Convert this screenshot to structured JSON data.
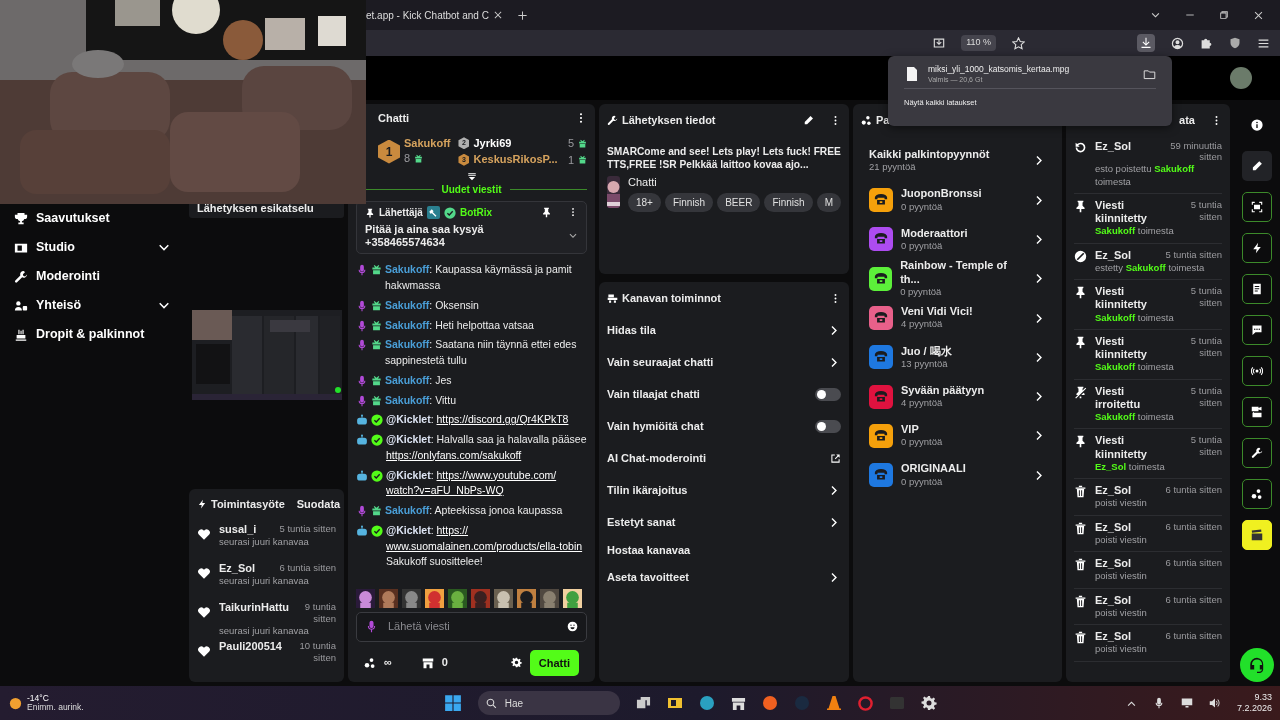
{
  "browser": {
    "tab_title": "et.app - Kick Chatbot and C",
    "zoom": "110 %"
  },
  "download": {
    "filename": "miksi_yli_1000_katsomis_kertaa.mpg",
    "status": "Valmis — 20,6 Gt",
    "show_all": "Näytä kaikki lataukset"
  },
  "sidebar": {
    "items": [
      {
        "label": "Saavutukset",
        "kind": "link"
      },
      {
        "label": "Studio",
        "kind": "group"
      },
      {
        "label": "Moderointi",
        "kind": "link"
      },
      {
        "label": "Yhteisö",
        "kind": "group"
      },
      {
        "label": "Dropit & palkinnot",
        "kind": "link"
      }
    ]
  },
  "preview": {
    "title": "Lähetyksen esikatselu"
  },
  "activity": {
    "title": "Toimintasyöte",
    "filter": "Suodata",
    "items": [
      {
        "user": "susal_i",
        "time": "5 tuntia sitten",
        "text": "seurasi juuri kanavaa"
      },
      {
        "user": "Ez_Sol",
        "time": "6 tuntia sitten",
        "text": "seurasi juuri kanavaa"
      },
      {
        "user": "TaikurinHattu",
        "time": "9 tuntia sitten",
        "text": "seurasi juuri kanavaa"
      },
      {
        "user": "Pauli200514",
        "time": "10 tuntia sitten"
      }
    ]
  },
  "chat": {
    "title": "Chatti",
    "leaders": [
      {
        "rank": "1",
        "name": "Sakukoff",
        "count": "8"
      },
      {
        "rank": "2",
        "name": "Jyrki69",
        "count": "5"
      },
      {
        "rank": "3",
        "name": "KeskusRikosP...",
        "count": "1"
      }
    ],
    "new_messages": "Uudet viestit",
    "pinned": {
      "label": "Lähettäjä",
      "user": "BotRix",
      "text": "Pitää ja aina saa kysyä +358465574634"
    },
    "messages": [
      {
        "kind": "user",
        "name": "Sakukoff",
        "sep": ":",
        "parts": [
          {
            "kind": "text",
            "value": "Kaupassa käymässä ja pamit hakwmassa"
          }
        ]
      },
      {
        "kind": "user",
        "name": "Sakukoff",
        "sep": ":",
        "parts": [
          {
            "kind": "text",
            "value": "Oksensin"
          }
        ]
      },
      {
        "kind": "user",
        "name": "Sakukoff",
        "sep": ":",
        "parts": [
          {
            "kind": "text",
            "value": "Heti helpottaa vatsaa"
          }
        ]
      },
      {
        "kind": "user",
        "name": "Sakukoff",
        "sep": ":",
        "parts": [
          {
            "kind": "text",
            "value": "Saatana niin täynnä ettei edes sappinestetä tullu"
          }
        ]
      },
      {
        "kind": "user",
        "name": "Sakukoff",
        "sep": ":",
        "parts": [
          {
            "kind": "text",
            "value": "Jes"
          }
        ]
      },
      {
        "kind": "user",
        "name": "Sakukoff",
        "sep": ":",
        "parts": [
          {
            "kind": "text",
            "value": "Vittu"
          }
        ]
      },
      {
        "kind": "bot",
        "name": "@Kicklet",
        "sep": ":",
        "parts": [
          {
            "kind": "link",
            "value": "https://discord.gg/Qr4KPkT8"
          }
        ]
      },
      {
        "kind": "bot",
        "name": "@Kicklet",
        "sep": ":",
        "parts": [
          {
            "kind": "text",
            "value": "Halvalla saa ja halavalla pääsee"
          },
          {
            "kind": "link",
            "value": "https://onlyfans.com/sakukoff"
          }
        ]
      },
      {
        "kind": "bot",
        "name": "@Kicklet",
        "sep": ":",
        "parts": [
          {
            "kind": "link",
            "value": "https://www.youtube.com/"
          },
          {
            "kind": "link",
            "value": "watch?v=aFU_NbPs-WQ"
          }
        ]
      },
      {
        "kind": "user",
        "name": "Sakukoff",
        "sep": ":",
        "parts": [
          {
            "kind": "text",
            "value": "Apteekissa jonoa kaupassa"
          }
        ]
      },
      {
        "kind": "bot",
        "name": "@Kicklet",
        "sep": ":",
        "parts": [
          {
            "kind": "link",
            "value": "https://"
          },
          {
            "kind": "link",
            "value": "www.suomalainen.com/products/ella-tobin"
          },
          {
            "kind": "text",
            "value": "Sakukoff suosittelee!"
          }
        ]
      }
    ],
    "input": {
      "placeholder": "Lähetä viesti"
    },
    "points": "∞",
    "shop_count": "0",
    "send": "Chatti"
  },
  "stream_info": {
    "title": "Lähetyksen tiedot",
    "stream_title": "SMARCome and see! Lets play! Lets fuck! FREE TTS,FREE !SR Pelkkää laittoo kovaa ajo...",
    "category": "Chatti",
    "tags": [
      "18+",
      "Finnish",
      "BEER",
      "Finnish",
      "M"
    ]
  },
  "channel_actions": {
    "title": "Kanavan toiminnot",
    "items": [
      {
        "kind": "link",
        "label": "Hidas tila"
      },
      {
        "kind": "link",
        "label": "Vain seuraajat chatti"
      },
      {
        "kind": "toggle",
        "label": "Vain tilaajat chatti",
        "on": false
      },
      {
        "kind": "toggle",
        "label": "Vain hymiöitä chat",
        "on": false
      },
      {
        "kind": "external",
        "label": "AI Chat-moderointi"
      },
      {
        "kind": "link",
        "label": "Tilin ikärajoitus"
      },
      {
        "kind": "link",
        "label": "Estetyt sanat"
      },
      {
        "kind": "plain",
        "label": "Hostaa kanavaa"
      },
      {
        "kind": "link",
        "label": "Aseta tavoitteet"
      }
    ]
  },
  "rewards": {
    "title": "Pa",
    "all": {
      "label": "Kaikki palkintopyynnöt",
      "count": "21 pyyntöä"
    },
    "items": [
      {
        "title": "JuoponBronssi",
        "count": "0 pyyntöä",
        "color": "#f5a00b"
      },
      {
        "title": "Moderaattori",
        "count": "0 pyyntöä",
        "color": "#ad4cf0"
      },
      {
        "title": "Rainbow - Temple of th...",
        "count": "0 pyyntöä",
        "color": "#5cf03a"
      },
      {
        "title": "Veni Vidi Vici!",
        "count": "4 pyyntöä",
        "color": "#e8608a"
      },
      {
        "title": "Juo / 喝水",
        "count": "13 pyyntöä",
        "color": "#1e78e0"
      },
      {
        "title": "Syvään päätyyn",
        "count": "4 pyyntöä",
        "color": "#e0123f"
      },
      {
        "title": "VIP",
        "count": "0 pyyntöä",
        "color": "#f5a00b"
      },
      {
        "title": "ORIGINAALI",
        "count": "0 pyyntöä",
        "color": "#1e78e0"
      }
    ]
  },
  "modlog": {
    "title": "ata",
    "items": [
      {
        "kind": "unban",
        "title": "Ez_Sol",
        "time": "59 minuuttia sitten",
        "pre": "esto poistettu",
        "by": "Sakukoff",
        "post": "toimesta"
      },
      {
        "kind": "pin",
        "title": "Viesti kiinnitetty",
        "time": "5 tuntia sitten",
        "by": "Sakukoff",
        "post": "toimesta"
      },
      {
        "kind": "ban",
        "title": "Ez_Sol",
        "time": "5 tuntia sitten",
        "pre": "estetty",
        "by": "Sakukoff",
        "post": "toimesta"
      },
      {
        "kind": "pin",
        "title": "Viesti kiinnitetty",
        "time": "5 tuntia sitten",
        "by": "Sakukoff",
        "post": "toimesta"
      },
      {
        "kind": "pin",
        "title": "Viesti kiinnitetty",
        "time": "5 tuntia sitten",
        "by": "Sakukoff",
        "post": "toimesta"
      },
      {
        "kind": "unpin",
        "title": "Viesti irroitettu",
        "time": "5 tuntia sitten",
        "by": "Sakukoff",
        "post": "toimesta"
      },
      {
        "kind": "pin",
        "title": "Viesti kiinnitetty",
        "time": "5 tuntia sitten",
        "by": "Ez_Sol",
        "post": "toimesta"
      },
      {
        "kind": "delete",
        "title": "Ez_Sol",
        "time": "6 tuntia sitten",
        "pre": "poisti viestin"
      },
      {
        "kind": "delete",
        "title": "Ez_Sol",
        "time": "6 tuntia sitten",
        "pre": "poisti viestin"
      },
      {
        "kind": "delete",
        "title": "Ez_Sol",
        "time": "6 tuntia sitten",
        "pre": "poisti viestin"
      },
      {
        "kind": "delete",
        "title": "Ez_Sol",
        "time": "6 tuntia sitten",
        "pre": "poisti viestin"
      },
      {
        "kind": "delete",
        "title": "Ez_Sol",
        "time": "6 tuntia sitten",
        "pre": "poisti viestin"
      }
    ]
  },
  "taskbar": {
    "temperature": "-14°C",
    "weather": "Enimm. aurink.",
    "search": "Hae",
    "time": "9.33",
    "date": "7.2.2026"
  }
}
